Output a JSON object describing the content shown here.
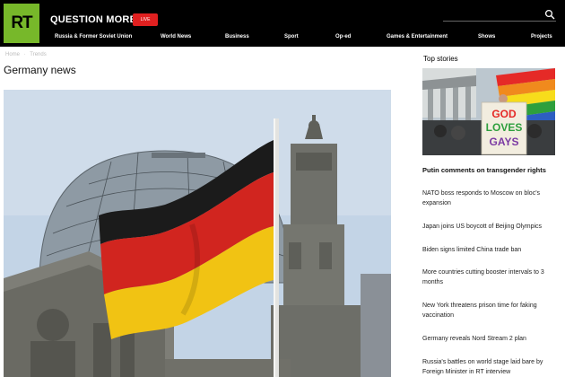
{
  "header": {
    "logo_text": "RT",
    "tagline": "QUESTION MORE",
    "live_label": "LIVE",
    "search_placeholder": "",
    "nav": [
      {
        "label": "Russia & Former Soviet Union"
      },
      {
        "label": "World News"
      },
      {
        "label": "Business"
      },
      {
        "label": "Sport"
      },
      {
        "label": "Op-ed"
      },
      {
        "label": "Games & Entertainment"
      },
      {
        "label": "Shows"
      },
      {
        "label": "Projects"
      }
    ]
  },
  "breadcrumb": [
    "Home",
    "Trends"
  ],
  "page": {
    "title": "Germany news"
  },
  "hero": {
    "flag_colors": [
      "#1b1b1b",
      "#d1251f",
      "#f1c313"
    ],
    "sky_color": "#c3d4e6",
    "stone_color": "#7c7c76"
  },
  "sidebar": {
    "title": "Top stories",
    "image": {
      "sign_lines": [
        "GOD",
        "LOVES",
        "GAYS"
      ]
    },
    "lead_story": "Putin comments on transgender rights",
    "stories": [
      "NATO boss responds to Moscow on bloc's expansion",
      "Japan joins US boycott of Beijing Olympics",
      "Biden signs limited China trade ban",
      "More countries cutting booster intervals to 3 months",
      "New York threatens prison time for faking vaccination",
      "Germany reveals Nord Stream 2 plan",
      "Russia's battles on world stage laid bare by Foreign Minister in RT interview"
    ]
  },
  "colors": {
    "brand_green": "#77b82a",
    "live_red": "#e02020",
    "topbar": "#000000"
  }
}
